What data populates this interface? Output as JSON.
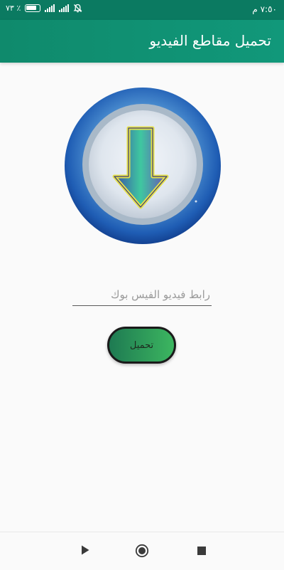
{
  "status_bar": {
    "time": "٧:٥٠ م",
    "battery_percent": "٪ ٧٣",
    "icons": [
      "battery-icon",
      "signal-icon",
      "signal-icon",
      "muted-bell-icon"
    ]
  },
  "app_bar": {
    "title": "تحميل مقاطع الفيديو",
    "color": "#0f8a6c"
  },
  "logo": {
    "icon": "download-arrow-icon"
  },
  "url_field": {
    "value": "",
    "placeholder": "رابط فيديو الفيس بوك"
  },
  "download_button": {
    "label": "تحميل"
  },
  "nav_bar": {
    "icons": [
      "back-triangle-icon",
      "home-circle-icon",
      "recents-square-icon"
    ]
  }
}
